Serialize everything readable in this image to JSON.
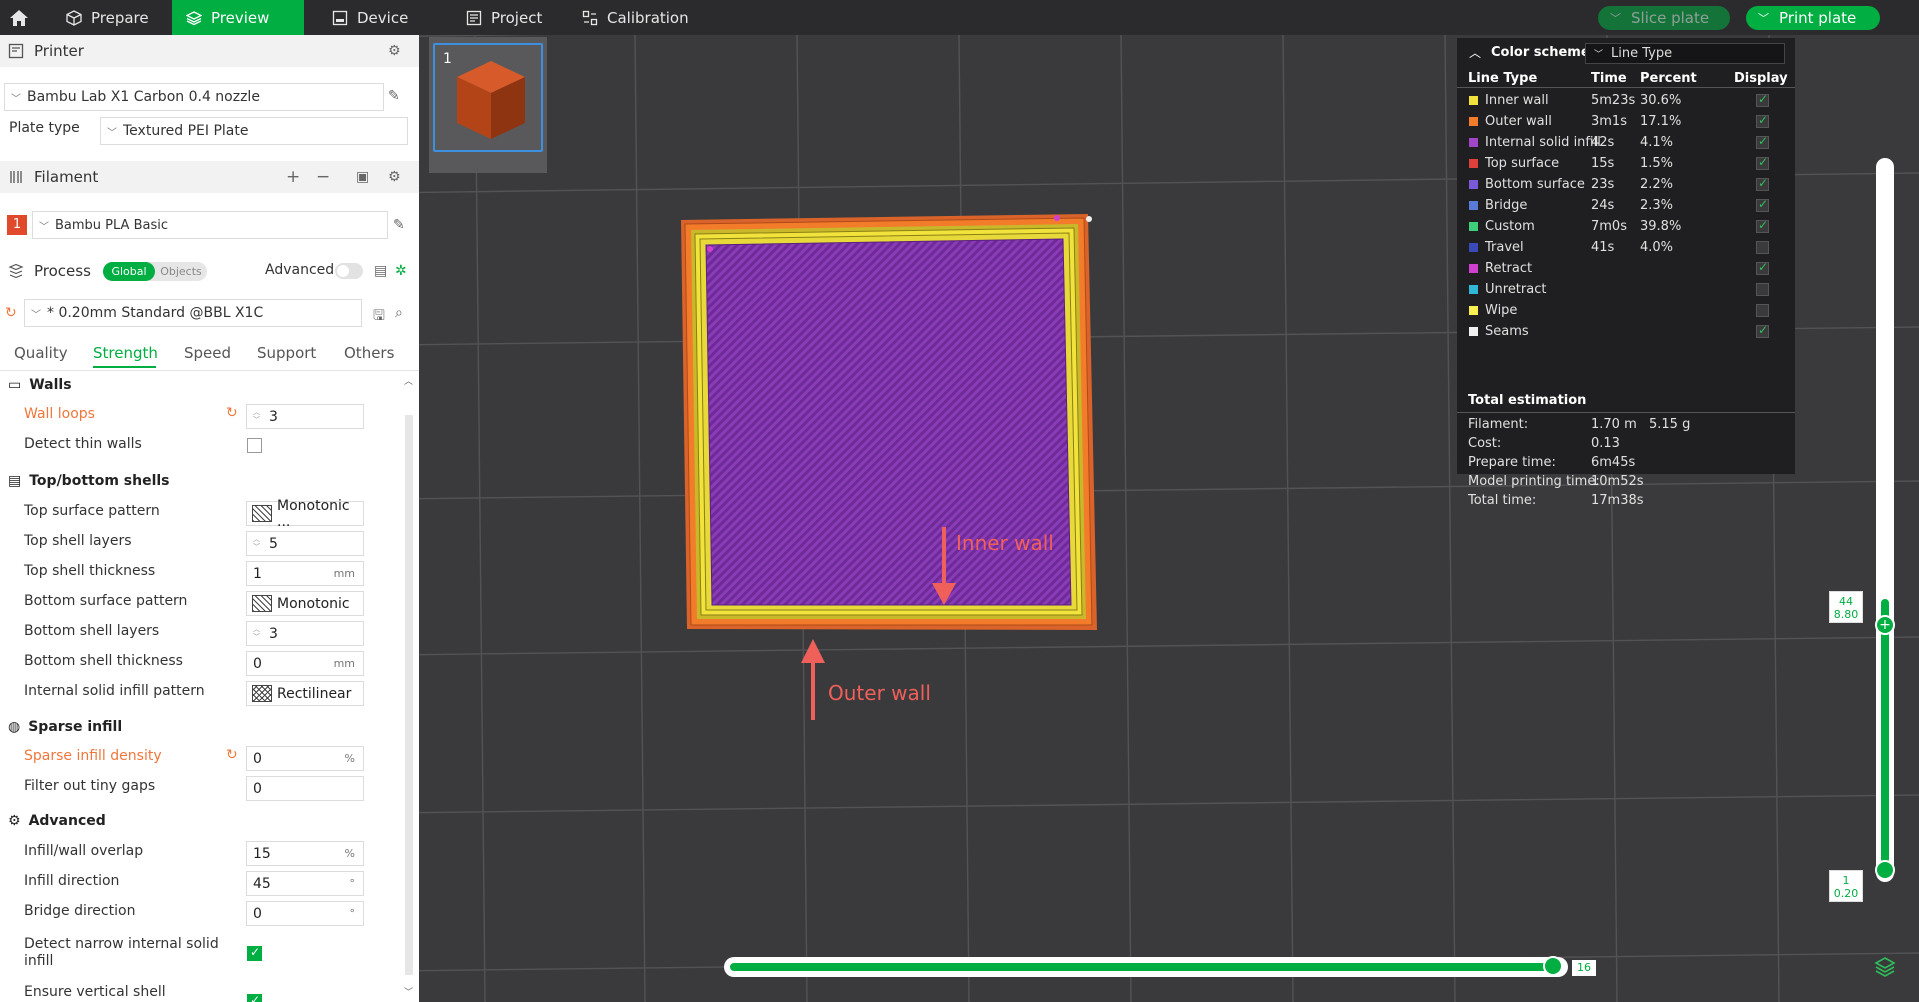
{
  "topbar": {
    "tabs": [
      {
        "label": "Prepare",
        "icon": "cube-icon"
      },
      {
        "label": "Preview",
        "icon": "layers-icon"
      },
      {
        "label": "Device",
        "icon": "device-icon"
      },
      {
        "label": "Project",
        "icon": "project-icon"
      },
      {
        "label": "Calibration",
        "icon": "calibration-icon"
      }
    ],
    "active_tab": "Preview",
    "slice_label": "Slice plate",
    "print_label": "Print plate",
    "accent": "#00ae42"
  },
  "printer": {
    "section_label": "Printer",
    "printer_name": "Bambu Lab X1 Carbon 0.4 nozzle",
    "plate_type_label": "Plate type",
    "plate_type": "Textured PEI Plate"
  },
  "filament": {
    "section_label": "Filament",
    "slot": "1",
    "slot_color": "#e04a2a",
    "name": "Bambu PLA Basic"
  },
  "process": {
    "section_label": "Process",
    "toggle_global": "Global",
    "toggle_objects": "Objects",
    "advanced_label": "Advanced",
    "preset": "* 0.20mm Standard @BBL X1C",
    "tabs": [
      "Quality",
      "Strength",
      "Speed",
      "Support",
      "Others"
    ],
    "active_tab": "Strength"
  },
  "settings": {
    "walls": {
      "title": "Walls",
      "wall_loops_label": "Wall loops",
      "wall_loops": "3",
      "detect_thin_label": "Detect thin walls"
    },
    "shells": {
      "title": "Top/bottom shells",
      "top_pattern_label": "Top surface pattern",
      "top_pattern": "Monotonic ...",
      "top_layers_label": "Top shell layers",
      "top_layers": "5",
      "top_thickness_label": "Top shell thickness",
      "top_thickness": "1",
      "bottom_pattern_label": "Bottom surface pattern",
      "bottom_pattern": "Monotonic",
      "bottom_layers_label": "Bottom shell layers",
      "bottom_layers": "3",
      "bottom_thickness_label": "Bottom shell thickness",
      "bottom_thickness": "0",
      "internal_pattern_label": "Internal solid infill pattern",
      "internal_pattern": "Rectilinear"
    },
    "sparse": {
      "title": "Sparse infill",
      "density_label": "Sparse infill density",
      "density": "0",
      "gaps_label": "Filter out tiny gaps",
      "gaps": "0"
    },
    "advanced": {
      "title": "Advanced",
      "overlap_label": "Infill/wall overlap",
      "overlap": "15",
      "direction_label": "Infill direction",
      "direction": "45",
      "bridge_label": "Bridge direction",
      "bridge": "0",
      "narrow_label_1": "Detect narrow internal solid",
      "narrow_label_2": "infill",
      "vertical_label": "Ensure vertical shell"
    },
    "units": {
      "mm": "mm",
      "percent": "%",
      "deg": "°"
    }
  },
  "viewport": {
    "plate_number": "1",
    "annotation_inner": "Inner wall",
    "annotation_outer": "Outer wall",
    "annotation_color": "#f0605a"
  },
  "legend": {
    "title": "Color scheme",
    "mode": "Line Type",
    "col_type": "Line Type",
    "col_time": "Time",
    "col_percent": "Percent",
    "col_display": "Display",
    "rows": [
      {
        "name": "Inner wall",
        "color": "#f2e33c",
        "time": "5m23s",
        "percent": "30.6%",
        "on": true
      },
      {
        "name": "Outer wall",
        "color": "#f27c2a",
        "time": "3m1s",
        "percent": "17.1%",
        "on": true
      },
      {
        "name": "Internal solid infill",
        "color": "#a044c8",
        "time": "42s",
        "percent": "4.1%",
        "on": true
      },
      {
        "name": "Top surface",
        "color": "#e0403a",
        "time": "15s",
        "percent": "1.5%",
        "on": true
      },
      {
        "name": "Bottom surface",
        "color": "#7a5ad8",
        "time": "23s",
        "percent": "2.2%",
        "on": true
      },
      {
        "name": "Bridge",
        "color": "#5a7ad8",
        "time": "24s",
        "percent": "2.3%",
        "on": true
      },
      {
        "name": "Custom",
        "color": "#3ecf7a",
        "time": "7m0s",
        "percent": "39.8%",
        "on": true
      },
      {
        "name": "Travel",
        "color": "#3a4ab8",
        "time": "41s",
        "percent": "4.0%",
        "on": false
      },
      {
        "name": "Retract",
        "color": "#d040d0",
        "time": "",
        "percent": "",
        "on": true
      },
      {
        "name": "Unretract",
        "color": "#30b8d8",
        "time": "",
        "percent": "",
        "on": false
      },
      {
        "name": "Wipe",
        "color": "#f8f050",
        "time": "",
        "percent": "",
        "on": false
      },
      {
        "name": "Seams",
        "color": "#f0f0f0",
        "time": "",
        "percent": "",
        "on": true
      }
    ],
    "estimation_title": "Total estimation",
    "est_filament_label": "Filament:",
    "est_filament_len": "1.70 m",
    "est_filament_g": "5.15 g",
    "est_cost_label": "Cost:",
    "est_cost": "0.13",
    "est_prep_label": "Prepare time:",
    "est_prep": "6m45s",
    "est_model_label": "Model printing time:",
    "est_model": "10m52s",
    "est_total_label": "Total time:",
    "est_total": "17m38s"
  },
  "layers": {
    "top_layer": "44",
    "top_height": "8.80",
    "bottom_layer": "1",
    "bottom_height": "0.20",
    "move_value": "16"
  }
}
